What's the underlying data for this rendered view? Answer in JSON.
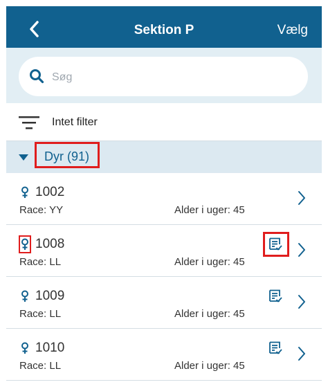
{
  "colors": {
    "brand": "#11618f",
    "highlight": "#e01d1d",
    "section_bg": "#dce9f1",
    "search_bg": "#e2eef4"
  },
  "header": {
    "title": "Sektion P",
    "action_label": "Vælg",
    "back_icon": "chevron-left-icon"
  },
  "search": {
    "placeholder": "Søg",
    "value": "",
    "icon": "search-icon"
  },
  "filter": {
    "label": "Intet filter",
    "icon": "filter-icon"
  },
  "section": {
    "title": "Dyr (91)",
    "expanded": true
  },
  "animals": [
    {
      "id": "1002",
      "race": "Race: YY",
      "age": "Alder i uger: 45",
      "has_note": false,
      "sex_icon": "female-icon"
    },
    {
      "id": "1008",
      "race": "Race: LL",
      "age": "Alder i uger: 45",
      "has_note": true,
      "sex_icon": "female-icon"
    },
    {
      "id": "1009",
      "race": "Race: LL",
      "age": "Alder i uger: 45",
      "has_note": true,
      "sex_icon": "female-icon"
    },
    {
      "id": "1010",
      "race": "Race: LL",
      "age": "Alder i uger: 45",
      "has_note": true,
      "sex_icon": "female-icon"
    }
  ]
}
